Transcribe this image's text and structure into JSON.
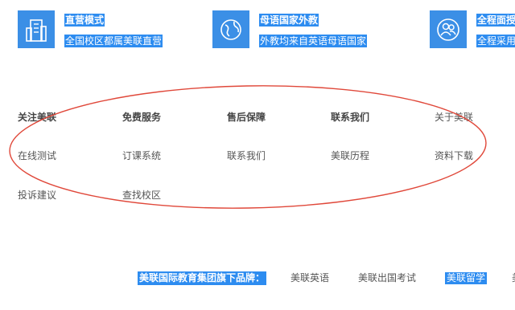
{
  "features": [
    {
      "title": "直营模式",
      "desc": "全国校区都属美联直营",
      "icon": "building-icon"
    },
    {
      "title": "母语国家外教",
      "desc": "外教均来自英语母语国家",
      "icon": "globe-icon"
    },
    {
      "title": "全程面授",
      "desc": "全程采用",
      "icon": "people-icon"
    }
  ],
  "nav": {
    "col1": {
      "heading": "关注美联",
      "links": [
        "在线测试",
        "投诉建议"
      ]
    },
    "col2": {
      "heading": "免费服务",
      "links": [
        "订课系统",
        "查找校区"
      ]
    },
    "col3": {
      "heading": "售后保障",
      "links": [
        "联系我们"
      ]
    },
    "col4": {
      "heading": "联系我们",
      "links": [
        "美联历程"
      ]
    },
    "col5": {
      "heading": "关于美联",
      "links": [
        "资料下载"
      ]
    }
  },
  "brands": {
    "label": "美联国际教育集团旗下品牌：",
    "items": [
      "美联英语",
      "美联出国考试",
      "美联留学",
      "美"
    ]
  },
  "colors": {
    "accent": "#2d8cf0",
    "annotation": "#e0483a"
  }
}
